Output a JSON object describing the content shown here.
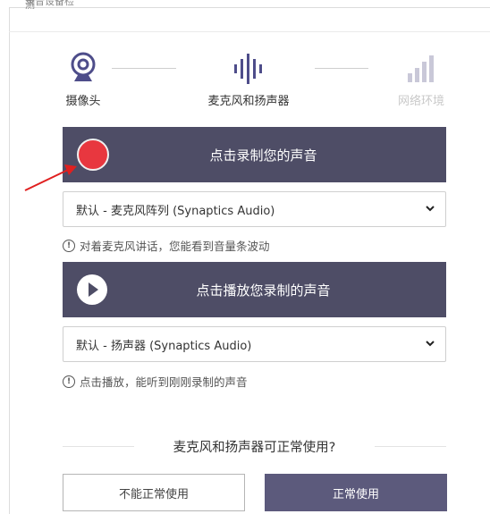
{
  "dialog": {
    "title_fragment": "录音设备检测"
  },
  "steps": [
    {
      "label": "摄像头",
      "icon": "webcam-icon",
      "state": "done"
    },
    {
      "label": "麦克风和扬声器",
      "icon": "soundwave-icon",
      "state": "active"
    },
    {
      "label": "网络环境",
      "icon": "signal-bars-icon",
      "state": "pending"
    }
  ],
  "record": {
    "label": "点击录制您的声音",
    "button_color": "#e8373f"
  },
  "microphone": {
    "selected": "默认 - 麦克风阵列 (Synaptics Audio)",
    "hint": "对着麦克风讲话，您能看到音量条波动"
  },
  "playback": {
    "label": "点击播放您录制的声音"
  },
  "speaker": {
    "selected": "默认 - 扬声器 (Synaptics Audio)",
    "hint": "点击播放，能听到刚刚录制的声音"
  },
  "question": "麦克风和扬声器可正常使用?",
  "buttons": {
    "no": "不能正常使用",
    "yes": "正常使用"
  },
  "colors": {
    "bar": "#4e4d66",
    "primary": "#5c5a7c",
    "record": "#e8373f",
    "arrow": "#e02020"
  }
}
